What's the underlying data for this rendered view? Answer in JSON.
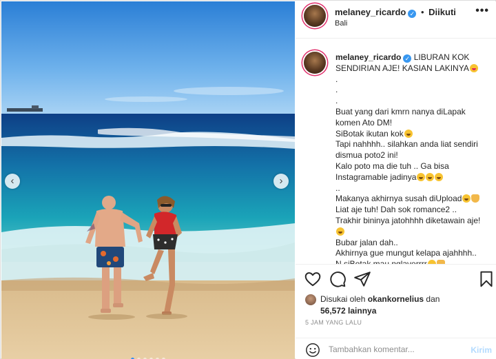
{
  "post": {
    "username": "melaney_ricardo",
    "bullet": "•",
    "follow_status": "Diikuti",
    "location": "Bali",
    "more_menu": "•••",
    "verified_badge": "✓"
  },
  "carousel": {
    "prev_label": "‹",
    "next_label": "›",
    "dot_count": 6,
    "active_dot": 1
  },
  "caption": {
    "username": "melaney_ricardo",
    "lines": [
      {
        "text": "LIBURAN KOK",
        "emoji": null
      },
      {
        "text": "SENDIRIAN AJE! KASIAN LAKINYA",
        "emoji": "tongue"
      },
      {
        "text": ".",
        "emoji": null
      },
      {
        "text": ".",
        "emoji": null
      },
      {
        "text": ".",
        "emoji": null
      },
      {
        "text": "Buat yang dari kmrn nanya diLapak",
        "emoji": null
      },
      {
        "text": "komen Ato DM!",
        "emoji": null
      },
      {
        "text": "SiBotak ikutan kok",
        "emoji": "smile"
      },
      {
        "text": "Tapi nahhhh.. silahkan anda liat sendiri",
        "emoji": null
      },
      {
        "text": "dismua poto2 ini!",
        "emoji": null
      },
      {
        "text": "Kalo poto ma die tuh .. Ga bisa",
        "emoji": null
      },
      {
        "text": "Instagramable jadinya",
        "emoji": "three"
      },
      {
        "text": "..",
        "emoji": null
      },
      {
        "text": "Makanya akhirnya susah diUpload",
        "emoji": "two-hand"
      },
      {
        "text": "Liat aje tuh! Dah sok romance2 ..",
        "emoji": null
      },
      {
        "text": "Trakhir bininya jatohhhh diketawain aje!",
        "emoji": null
      },
      {
        "text": "",
        "emoji": "smile"
      },
      {
        "text": "Bubar jalan dah..",
        "emoji": null
      },
      {
        "text": "Akhirnya gue mungut kelapa ajahhhh..",
        "emoji": null
      },
      {
        "text": "N siBotak mau nglaverrrr",
        "emoji": "two-hand"
      }
    ]
  },
  "actions": {
    "like_icon": "heart-icon",
    "comment_icon": "comment-icon",
    "share_icon": "share-icon",
    "save_icon": "bookmark-icon"
  },
  "likes": {
    "prefix": "Disukai oleh",
    "liker": "okankornelius",
    "connector": "dan",
    "count": "56,572",
    "suffix": "lainnya"
  },
  "timestamp": "5 JAM YANG LALU",
  "comment": {
    "placeholder": "Tambahkan komentar...",
    "send_label": "Kirim"
  },
  "colors": {
    "accent": "#3897f0",
    "story_ring": "#e1306c",
    "send_disabled": "#b3dbff"
  }
}
